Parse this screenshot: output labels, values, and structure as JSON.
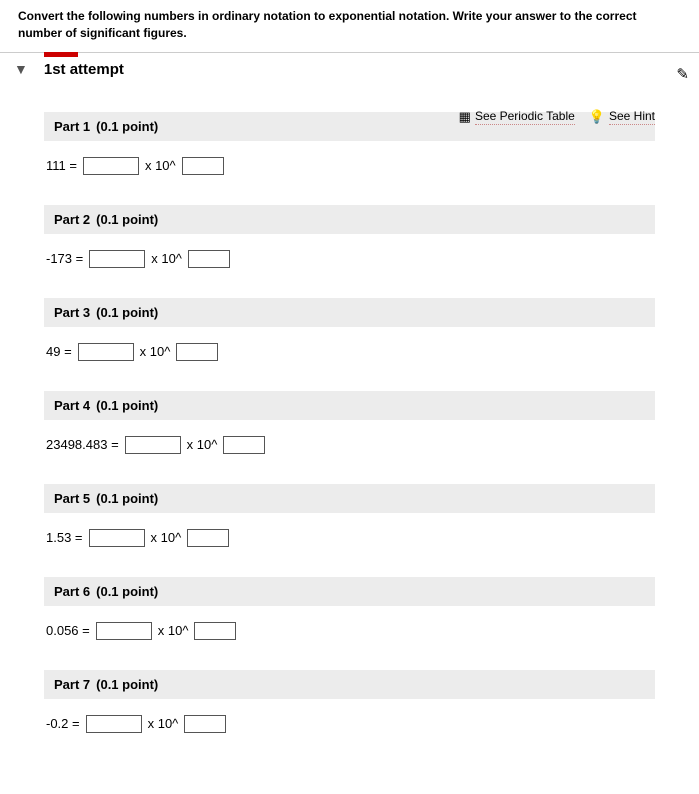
{
  "instructions": "Convert the following numbers in ordinary notation to exponential notation. Write your answer to the correct number of significant figures.",
  "attempt_label": "1st attempt",
  "links": {
    "periodic": "See Periodic Table",
    "hint": "See Hint"
  },
  "x10": "x 10^",
  "parts": [
    {
      "label": "Part 1",
      "points": "(0.1 point)",
      "lhs": "111 ="
    },
    {
      "label": "Part 2",
      "points": "(0.1 point)",
      "lhs": "-173 ="
    },
    {
      "label": "Part 3",
      "points": "(0.1 point)",
      "lhs": "49 ="
    },
    {
      "label": "Part 4",
      "points": "(0.1 point)",
      "lhs": "23498.483 ="
    },
    {
      "label": "Part 5",
      "points": "(0.1 point)",
      "lhs": "1.53 ="
    },
    {
      "label": "Part 6",
      "points": "(0.1 point)",
      "lhs": "0.056 ="
    },
    {
      "label": "Part 7",
      "points": "(0.1 point)",
      "lhs": "-0.2 ="
    }
  ]
}
